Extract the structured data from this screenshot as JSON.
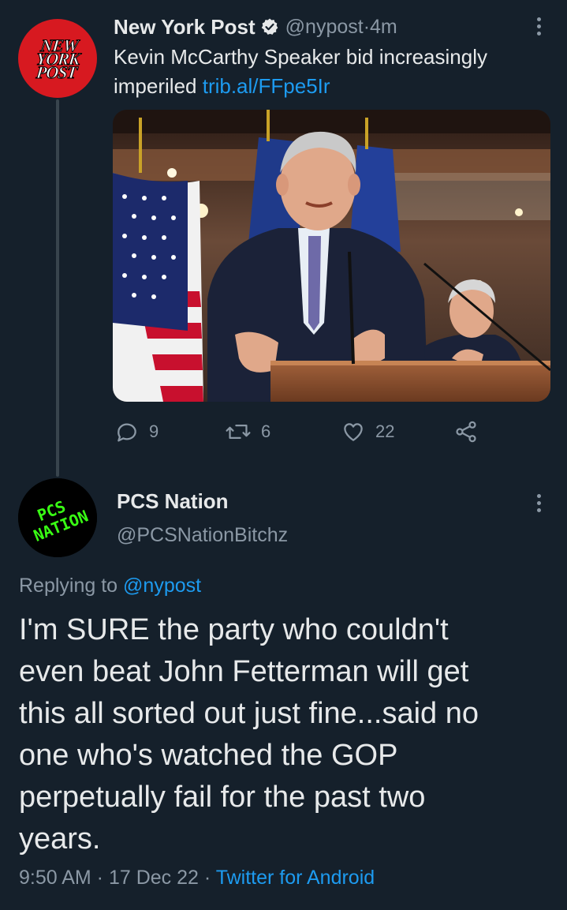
{
  "tweet1": {
    "name": "New York Post",
    "handle": "@nypost",
    "separator": " · ",
    "time": "4m",
    "text": "Kevin McCarthy Speaker bid increasingly imperiled ",
    "link": "trib.al/FFpe5Ir",
    "avatar_logo_lines": [
      "NEW",
      "YORK",
      "POST"
    ],
    "stats": {
      "replies": "9",
      "retweets": "6",
      "likes": "22"
    }
  },
  "tweet2": {
    "name": "PCS Nation",
    "handle": "@PCSNationBitchz",
    "avatar_logo_lines": [
      "PCS",
      "NATION"
    ],
    "replying_prefix": "Replying to ",
    "replying_handle": "@nypost",
    "body": "I'm SURE the party who couldn't\neven beat John Fetterman will get\nthis all sorted out just fine...said no\none who's watched the GOP\nperpetually fail for the past two\nyears.",
    "time": "9:50 AM",
    "date": "17 Dec 22",
    "app": "Twitter for Android",
    "dot": " · "
  },
  "colors": {
    "background": "#15202b",
    "text": "#e7e9ea",
    "muted": "#8b98a5",
    "link": "#1d9bf0",
    "nypost_red": "#d71920",
    "pcs_green": "#39ff14"
  },
  "icons": [
    "verified-badge-icon",
    "more-options-icon",
    "reply-icon",
    "retweet-icon",
    "like-icon",
    "share-icon"
  ]
}
